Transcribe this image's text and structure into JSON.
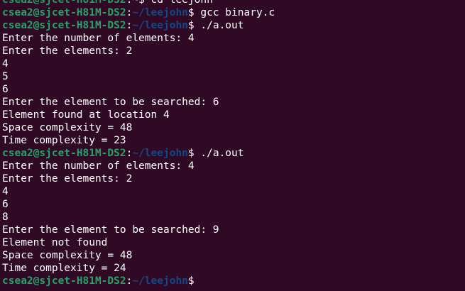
{
  "terminal": {
    "colors": {
      "background": "#300a24",
      "foreground": "#ffffff",
      "prompt_user": "#26a269",
      "prompt_path": "#12488b"
    },
    "top_partial": {
      "user": "csea2@sjcet-H81M-DS2",
      "rest": ":~$ cd leejohn"
    },
    "prompt": {
      "user": "csea2@sjcet-H81M-DS2",
      "colon": ":",
      "path": "~/leejohn",
      "dollar": "$ "
    },
    "lines": [
      {
        "type": "prompt",
        "command": "gcc binary.c"
      },
      {
        "type": "prompt",
        "command": "./a.out"
      },
      {
        "type": "output",
        "text": "Enter the number of elements: 4"
      },
      {
        "type": "output",
        "text": "Enter the elements: 2"
      },
      {
        "type": "output",
        "text": "4"
      },
      {
        "type": "output",
        "text": "5"
      },
      {
        "type": "output",
        "text": "6"
      },
      {
        "type": "output",
        "text": "Enter the element to be searched: 6"
      },
      {
        "type": "output",
        "text": "Element found at location 4"
      },
      {
        "type": "output",
        "text": "Space complexity = 48"
      },
      {
        "type": "output",
        "text": "Time complexity = 23"
      },
      {
        "type": "prompt",
        "command": "./a.out"
      },
      {
        "type": "output",
        "text": "Enter the number of elements: 4"
      },
      {
        "type": "output",
        "text": "Enter the elements: 2"
      },
      {
        "type": "output",
        "text": "4"
      },
      {
        "type": "output",
        "text": "6"
      },
      {
        "type": "output",
        "text": "8"
      },
      {
        "type": "output",
        "text": "Enter the element to be searched: 9"
      },
      {
        "type": "output",
        "text": "Element not found"
      },
      {
        "type": "output",
        "text": "Space complexity = 48"
      },
      {
        "type": "output",
        "text": "Time complexity = 24"
      },
      {
        "type": "prompt",
        "command": ""
      }
    ]
  }
}
